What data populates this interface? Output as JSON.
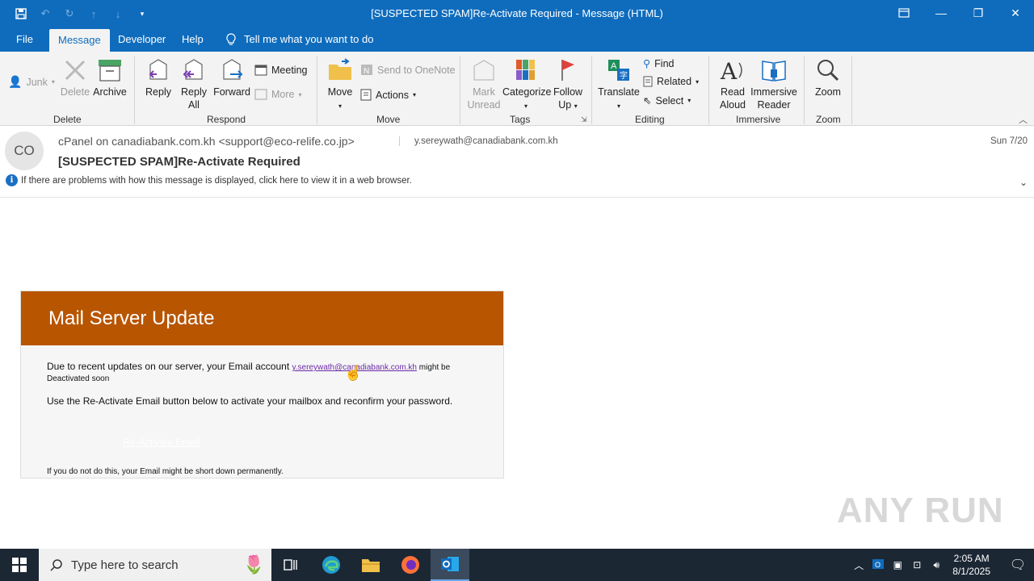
{
  "window": {
    "title": "[SUSPECTED SPAM]Re-Activate Required  -  Message (HTML)"
  },
  "tabs": [
    {
      "label": "File"
    },
    {
      "label": "Message"
    },
    {
      "label": "Developer"
    },
    {
      "label": "Help"
    }
  ],
  "tell_me": "Tell me what you want to do",
  "ribbon": {
    "delete_group": {
      "label": "Delete",
      "junk": "Junk",
      "delete": "Delete",
      "archive": "Archive"
    },
    "respond_group": {
      "label": "Respond",
      "reply": "Reply",
      "reply_all_1": "Reply",
      "reply_all_2": "All",
      "forward": "Forward",
      "meeting": "Meeting",
      "more": "More"
    },
    "move_group": {
      "label": "Move",
      "move": "Move",
      "send_onenote": "Send to OneNote",
      "actions": "Actions"
    },
    "tags_group": {
      "label": "Tags",
      "mark_unread_1": "Mark",
      "mark_unread_2": "Unread",
      "categorize": "Categorize",
      "follow_up_1": "Follow",
      "follow_up_2": "Up"
    },
    "editing_group": {
      "label": "Editing",
      "translate": "Translate",
      "find": "Find",
      "related": "Related",
      "select": "Select"
    },
    "immersive_group": {
      "label": "Immersive",
      "read_aloud_1": "Read",
      "read_aloud_2": "Aloud",
      "immersive_reader_1": "Immersive",
      "immersive_reader_2": "Reader"
    },
    "zoom_group": {
      "label": "Zoom",
      "zoom": "Zoom"
    }
  },
  "message": {
    "avatar_initials": "CO",
    "from": "cPanel on canadiabank.com.kh <support@eco-relife.co.jp>",
    "to": "y.sereywath@canadiabank.com.kh",
    "date": "Sun 7/20",
    "subject": "[SUSPECTED SPAM]Re-Activate Required",
    "info_bar": "If there are problems with how this message is displayed, click here to view it in a web browser."
  },
  "email_body": {
    "banner_title": "Mail Server Update",
    "p1_text": "Due to recent updates on our server, your Email account ",
    "p1_link": "y.sereywath@canadiabank.com.kh",
    "p1_tail": " might be",
    "p1_line2": "Deactivated soon",
    "p2": "Use the Re-Activate Email button below to activate your mailbox and reconfirm your password.",
    "cta": "Re-Activate Email",
    "p3": "If you do not do this, your Email might be short down permanently.",
    "banner_color": "#b85500"
  },
  "watermark": "ANY RUN",
  "taskbar": {
    "search_placeholder": "Type here to search",
    "time": "2:05 AM",
    "date": "8/1/2025"
  }
}
